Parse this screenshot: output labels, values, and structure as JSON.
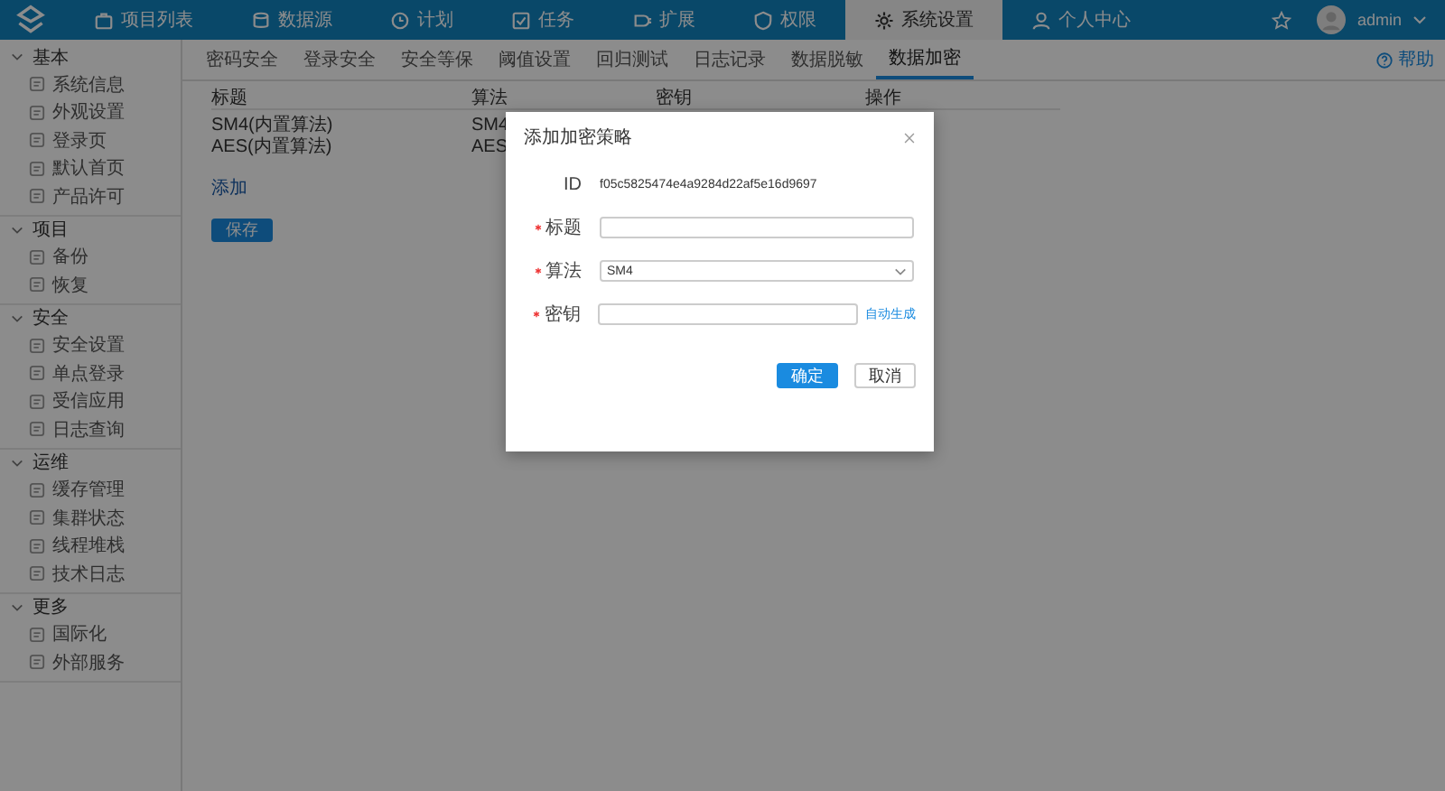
{
  "nav": {
    "items": [
      {
        "label": "项目列表",
        "selected": false
      },
      {
        "label": "数据源",
        "selected": false
      },
      {
        "label": "计划",
        "selected": false
      },
      {
        "label": "任务",
        "selected": false
      },
      {
        "label": "扩展",
        "selected": false
      },
      {
        "label": "权限",
        "selected": false
      },
      {
        "label": "系统设置",
        "selected": true
      },
      {
        "label": "个人中心",
        "selected": false
      }
    ],
    "user": "admin"
  },
  "sidebar": {
    "groups": [
      {
        "label": "基本",
        "expanded": true,
        "items": [
          "系统信息",
          "外观设置",
          "登录页",
          "默认首页",
          "产品许可"
        ]
      },
      {
        "label": "项目",
        "expanded": true,
        "items": [
          "备份",
          "恢复"
        ]
      },
      {
        "label": "安全",
        "expanded": true,
        "items": [
          "安全设置",
          "单点登录",
          "受信应用",
          "日志查询"
        ]
      },
      {
        "label": "运维",
        "expanded": true,
        "items": [
          "缓存管理",
          "集群状态",
          "线程堆栈",
          "技术日志"
        ]
      },
      {
        "label": "更多",
        "expanded": true,
        "items": [
          "国际化",
          "外部服务"
        ]
      }
    ]
  },
  "tabs": [
    {
      "label": "密码安全",
      "selected": false
    },
    {
      "label": "登录安全",
      "selected": false
    },
    {
      "label": "安全等保",
      "selected": false
    },
    {
      "label": "阈值设置",
      "selected": false
    },
    {
      "label": "回归测试",
      "selected": false
    },
    {
      "label": "日志记录",
      "selected": false
    },
    {
      "label": "数据脱敏",
      "selected": false
    },
    {
      "label": "数据加密",
      "selected": true
    }
  ],
  "help": "帮助",
  "table": {
    "columns": [
      "标题",
      "算法",
      "密钥",
      "操作"
    ],
    "rows": [
      [
        "SM4(内置算法)",
        "SM4"
      ],
      [
        "AES(内置算法)",
        "AES"
      ]
    ]
  },
  "add_link": "添加",
  "save_button": "保存",
  "dialog": {
    "title": "添加加密策略",
    "id_label": "ID",
    "id_value": "f05c5825474e4a9284d22af5e16d9697",
    "fields": [
      {
        "kind": "text",
        "label": "标题",
        "required": true
      },
      {
        "kind": "select",
        "label": "算法",
        "required": true,
        "value": "SM4"
      },
      {
        "kind": "text",
        "label": "密钥",
        "required": true,
        "link": "自动生成"
      }
    ],
    "buttons": [
      {
        "label": "确定",
        "primary": true
      },
      {
        "label": "取消",
        "primary": false
      }
    ]
  }
}
